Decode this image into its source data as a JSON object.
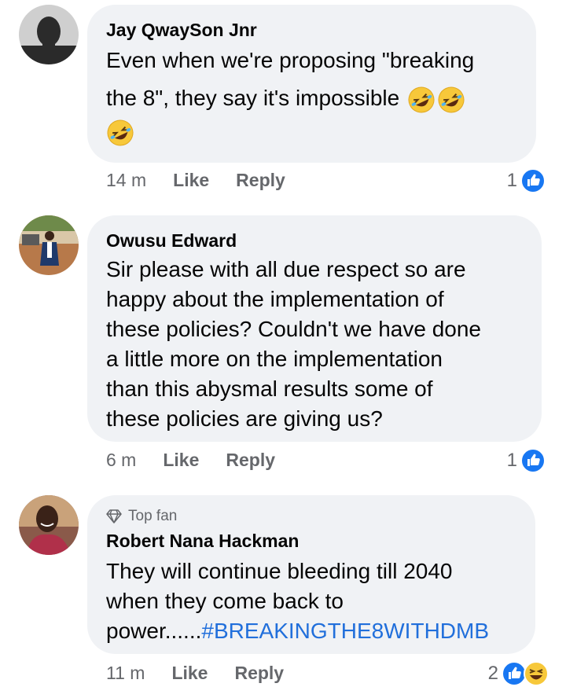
{
  "comments": [
    {
      "author": "Jay QwaySon Jnr",
      "text_line1": "Even when we're proposing \"breaking",
      "text_line2": "the 8\", they say it's impossible",
      "time": "14 m",
      "like_label": "Like",
      "reply_label": "Reply",
      "reaction_count": "1",
      "emojis": [
        "rolling-on-floor-laughing",
        "rolling-on-floor-laughing",
        "rolling-on-floor-laughing"
      ]
    },
    {
      "author": "Owusu Edward",
      "text_lines": [
        "Sir please with all due respect so are",
        "happy about the implementation of",
        "these policies? Couldn't we have done",
        "a little more on the implementation",
        "than this abysmal results some of",
        "these policies are giving us?"
      ],
      "time": "6 m",
      "like_label": "Like",
      "reply_label": "Reply",
      "reaction_count": "1"
    },
    {
      "badge": "Top fan",
      "author": "Robert Nana Hackman",
      "text_line1": "They will continue bleeding till 2040",
      "text_line2": "when they come back to",
      "text_line3_plain": "power......",
      "hashtag": "#BREAKINGTHE8WITHDMB",
      "time": "11 m",
      "like_label": "Like",
      "reply_label": "Reply",
      "reaction_count": "2"
    }
  ],
  "colors": {
    "bubble": "#f0f2f5",
    "like_blue": "#1877f2",
    "hashtag": "#216fdb",
    "meta_gray": "#65676b"
  }
}
